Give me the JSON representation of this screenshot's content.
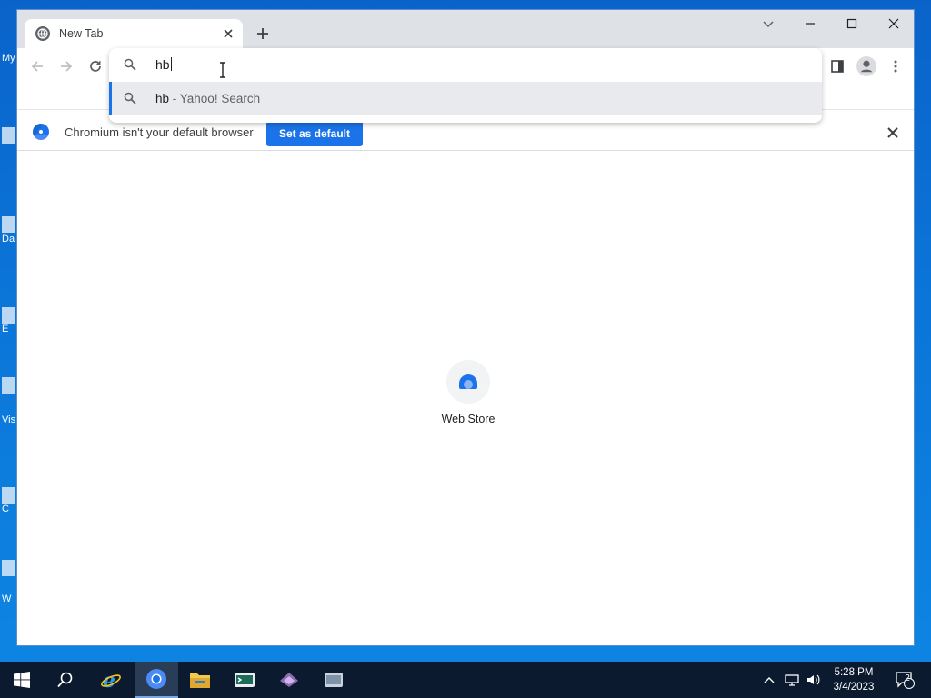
{
  "desktop": {
    "icon_labels": [
      "My",
      "Da",
      "E",
      "Vis",
      "C",
      "W"
    ]
  },
  "browser": {
    "tab": {
      "title": "New Tab"
    },
    "omnibox": {
      "query": "hb",
      "suggestion": {
        "query": "hb",
        "rest": " - Yahoo! Search"
      }
    },
    "infobar": {
      "message": "Chromium isn't your default browser",
      "button_label": "Set as default"
    },
    "shortcuts": [
      {
        "label": "Web Store"
      }
    ],
    "accent_color": "#1a73e8"
  },
  "taskbar": {
    "apps": [
      "start",
      "search",
      "internet-explorer",
      "chromium",
      "file-explorer",
      "app-5",
      "app-6",
      "app-7"
    ],
    "clock": {
      "time": "5:28 PM",
      "date": "3/4/2023"
    },
    "notification_count": "2"
  }
}
